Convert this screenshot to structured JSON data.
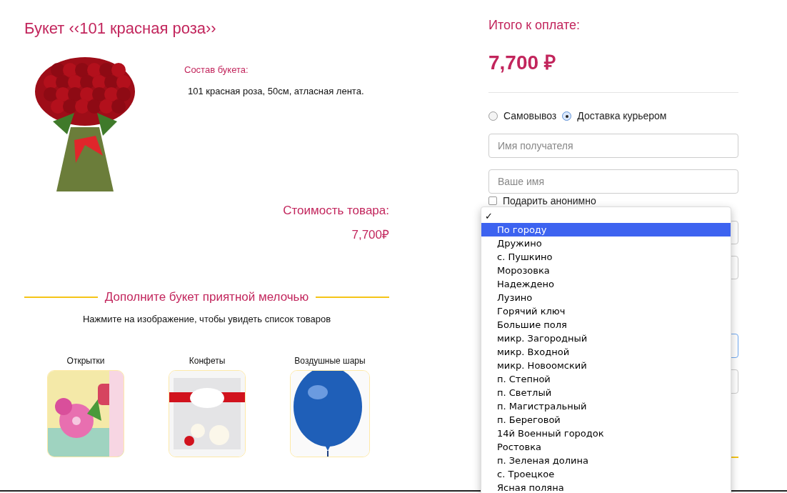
{
  "product": {
    "title": "Букет ‹‹101 красная роза››",
    "composition_label": "Состав букета:",
    "composition": "101 красная роза, 50см, атласная лента.",
    "price_label": "Стоимость товара:",
    "price": "7,700₽"
  },
  "extras": {
    "heading": "Дополните букет приятной мелочью",
    "hint": "Нажмите на изображение, чтобы увидеть список товаров",
    "items": [
      {
        "label": "Открытки",
        "kind": "card"
      },
      {
        "label": "Конфеты",
        "kind": "candy"
      },
      {
        "label": "Воздушные шары",
        "kind": "balloon"
      }
    ]
  },
  "order": {
    "total_label": "Итого к оплате:",
    "total": "7,700 ₽",
    "delivery": [
      {
        "label": "Самовывоз",
        "selected": false
      },
      {
        "label": "Доставка курьером",
        "selected": true
      }
    ],
    "fields": [
      {
        "placeholder": "Имя получателя"
      },
      {
        "placeholder": "Ваше имя"
      }
    ],
    "anonymous": {
      "label": "Подарить анонимно",
      "checked": false
    }
  },
  "menu": {
    "current_mark": "✓",
    "options": [
      {
        "label": "По городу",
        "selected": true
      },
      {
        "label": "Дружино",
        "selected": false
      },
      {
        "label": "с. Пушкино",
        "selected": false
      },
      {
        "label": "Морозовка",
        "selected": false
      },
      {
        "label": "Надеждено",
        "selected": false
      },
      {
        "label": "Лузино",
        "selected": false
      },
      {
        "label": "Горячий ключ",
        "selected": false
      },
      {
        "label": "Большие поля",
        "selected": false
      },
      {
        "label": "микр. Загородный",
        "selected": false
      },
      {
        "label": "микр. Входной",
        "selected": false
      },
      {
        "label": "микр. Новоомский",
        "selected": false
      },
      {
        "label": "п. Степной",
        "selected": false
      },
      {
        "label": "п. Светлый",
        "selected": false
      },
      {
        "label": "п. Магистральный",
        "selected": false
      },
      {
        "label": "п. Береговой",
        "selected": false
      },
      {
        "label": "14й Военный городок",
        "selected": false
      },
      {
        "label": "Ростовка",
        "selected": false
      },
      {
        "label": "п. Зеленая долина",
        "selected": false
      },
      {
        "label": "с. Троецкое",
        "selected": false
      },
      {
        "label": "Ясная поляна",
        "selected": false
      }
    ]
  }
}
